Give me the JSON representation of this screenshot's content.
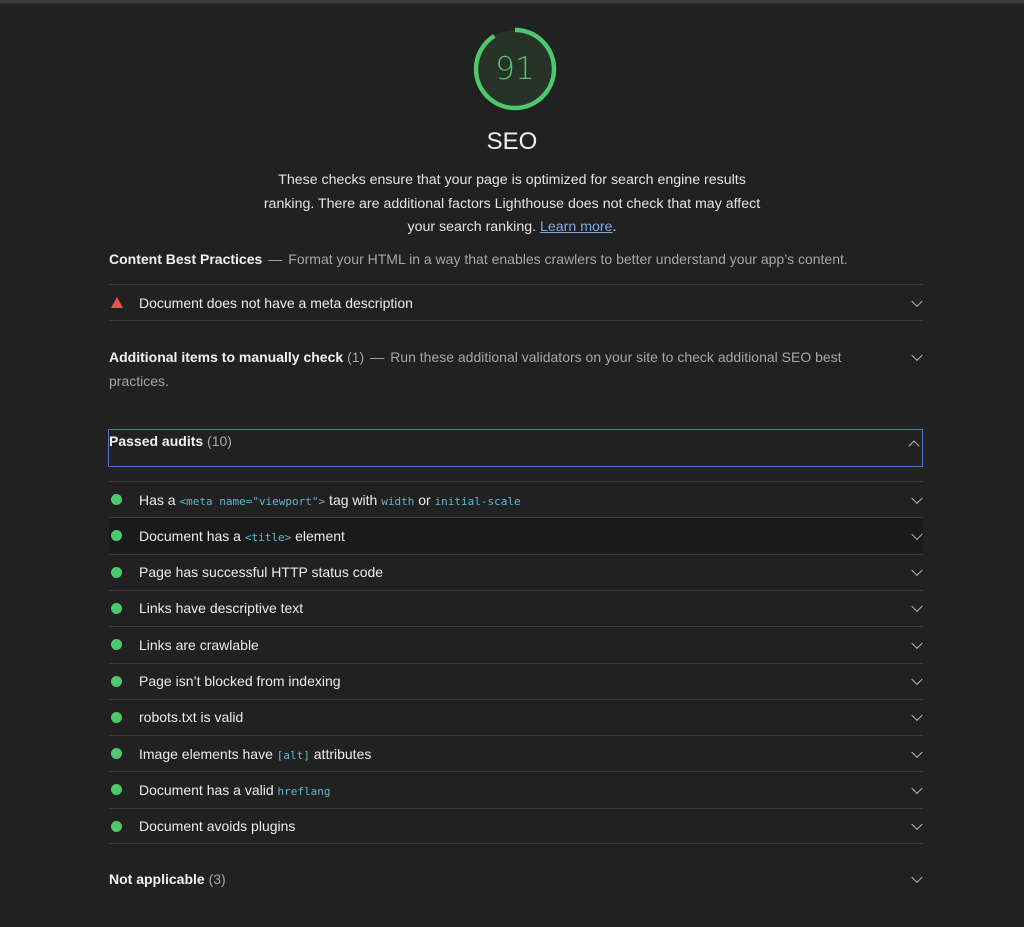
{
  "gauge": {
    "score": "91",
    "score_fraction": 0.91,
    "title": "SEO",
    "color": "#4cc96c"
  },
  "description": {
    "text": "These checks ensure that your page is optimized for search engine results ranking. There are additional factors Lighthouse does not check that may affect your search ranking. ",
    "link_label": "Learn more",
    "end": "."
  },
  "content_best_practices": {
    "title": "Content Best Practices",
    "separator": "—",
    "description": "Format your HTML in a way that enables crawlers to better understand your app’s content.",
    "audits": [
      {
        "status": "fail",
        "status_color": "#e8534a",
        "title": "Document does not have a meta description"
      }
    ]
  },
  "manual_check": {
    "title": "Additional items to manually check",
    "count": "(1)",
    "separator": "—",
    "description": "Run these additional validators on your site to check additional SEO best practices."
  },
  "passed_audits": {
    "title": "Passed audits",
    "count": "(10)",
    "status_color": "#4cc96c",
    "items": [
      {
        "parts": [
          {
            "t": "Has a "
          },
          {
            "c": "<meta name=\"viewport\">"
          },
          {
            "t": " tag with "
          },
          {
            "c": "width"
          },
          {
            "t": " or "
          },
          {
            "c": "initial-scale"
          }
        ]
      },
      {
        "parts": [
          {
            "t": "Document has a "
          },
          {
            "c": "<title>"
          },
          {
            "t": " element"
          }
        ]
      },
      {
        "parts": [
          {
            "t": "Page has successful HTTP status code"
          }
        ]
      },
      {
        "parts": [
          {
            "t": "Links have descriptive text"
          }
        ]
      },
      {
        "parts": [
          {
            "t": "Links are crawlable"
          }
        ]
      },
      {
        "parts": [
          {
            "t": "Page isn’t blocked from indexing"
          }
        ]
      },
      {
        "parts": [
          {
            "t": "robots.txt is valid"
          }
        ]
      },
      {
        "parts": [
          {
            "t": "Image elements have "
          },
          {
            "c": "[alt]"
          },
          {
            "t": " attributes"
          }
        ]
      },
      {
        "parts": [
          {
            "t": "Document has a valid "
          },
          {
            "c": "hreflang"
          }
        ]
      },
      {
        "parts": [
          {
            "t": "Document avoids plugins"
          }
        ]
      }
    ]
  },
  "not_applicable": {
    "title": "Not applicable",
    "count": "(3)"
  }
}
